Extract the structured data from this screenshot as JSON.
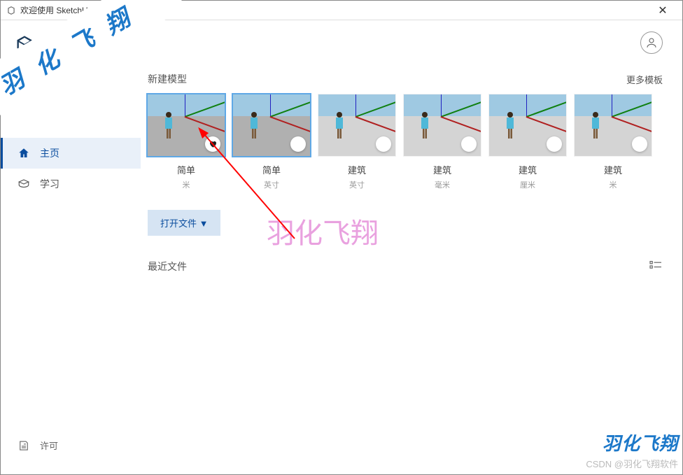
{
  "titlebar": {
    "title": "欢迎使用 SketchUp"
  },
  "brand": {
    "name": "SketchUp",
    "logo_color": "#1a3a5a"
  },
  "sidebar": {
    "items": [
      {
        "icon": "home-icon",
        "label": "主页",
        "active": true
      },
      {
        "icon": "learn-icon",
        "label": "学习",
        "active": false
      }
    ],
    "license_label": "许可"
  },
  "header": {
    "account_icon": "user-icon"
  },
  "sections": {
    "new_model_label": "新建模型",
    "more_templates_label": "更多模板",
    "open_file_label": "打开文件 ▼",
    "recent_files_label": "最近文件"
  },
  "templates": [
    {
      "name": "简单",
      "unit": "米",
      "selected": true,
      "favorited": true
    },
    {
      "name": "简单",
      "unit": "英寸",
      "selected": true,
      "favorited": false
    },
    {
      "name": "建筑",
      "unit": "英寸",
      "selected": false,
      "favorited": false
    },
    {
      "name": "建筑",
      "unit": "毫米",
      "selected": false,
      "favorited": false
    },
    {
      "name": "建筑",
      "unit": "厘米",
      "selected": false,
      "favorited": false
    },
    {
      "name": "建筑",
      "unit": "米",
      "selected": false,
      "favorited": false
    }
  ],
  "watermarks": {
    "ribbon_text": "羽化飞翔",
    "center_text": "羽化飞翔",
    "corner_text_main": "羽化飞翔",
    "corner_text_sub": "CSDN @羽化飞翔软件"
  },
  "colors": {
    "accent": "#0a4d9e",
    "watermark_pink": "#e9a1df",
    "watermark_blue": "#1c78c9"
  }
}
